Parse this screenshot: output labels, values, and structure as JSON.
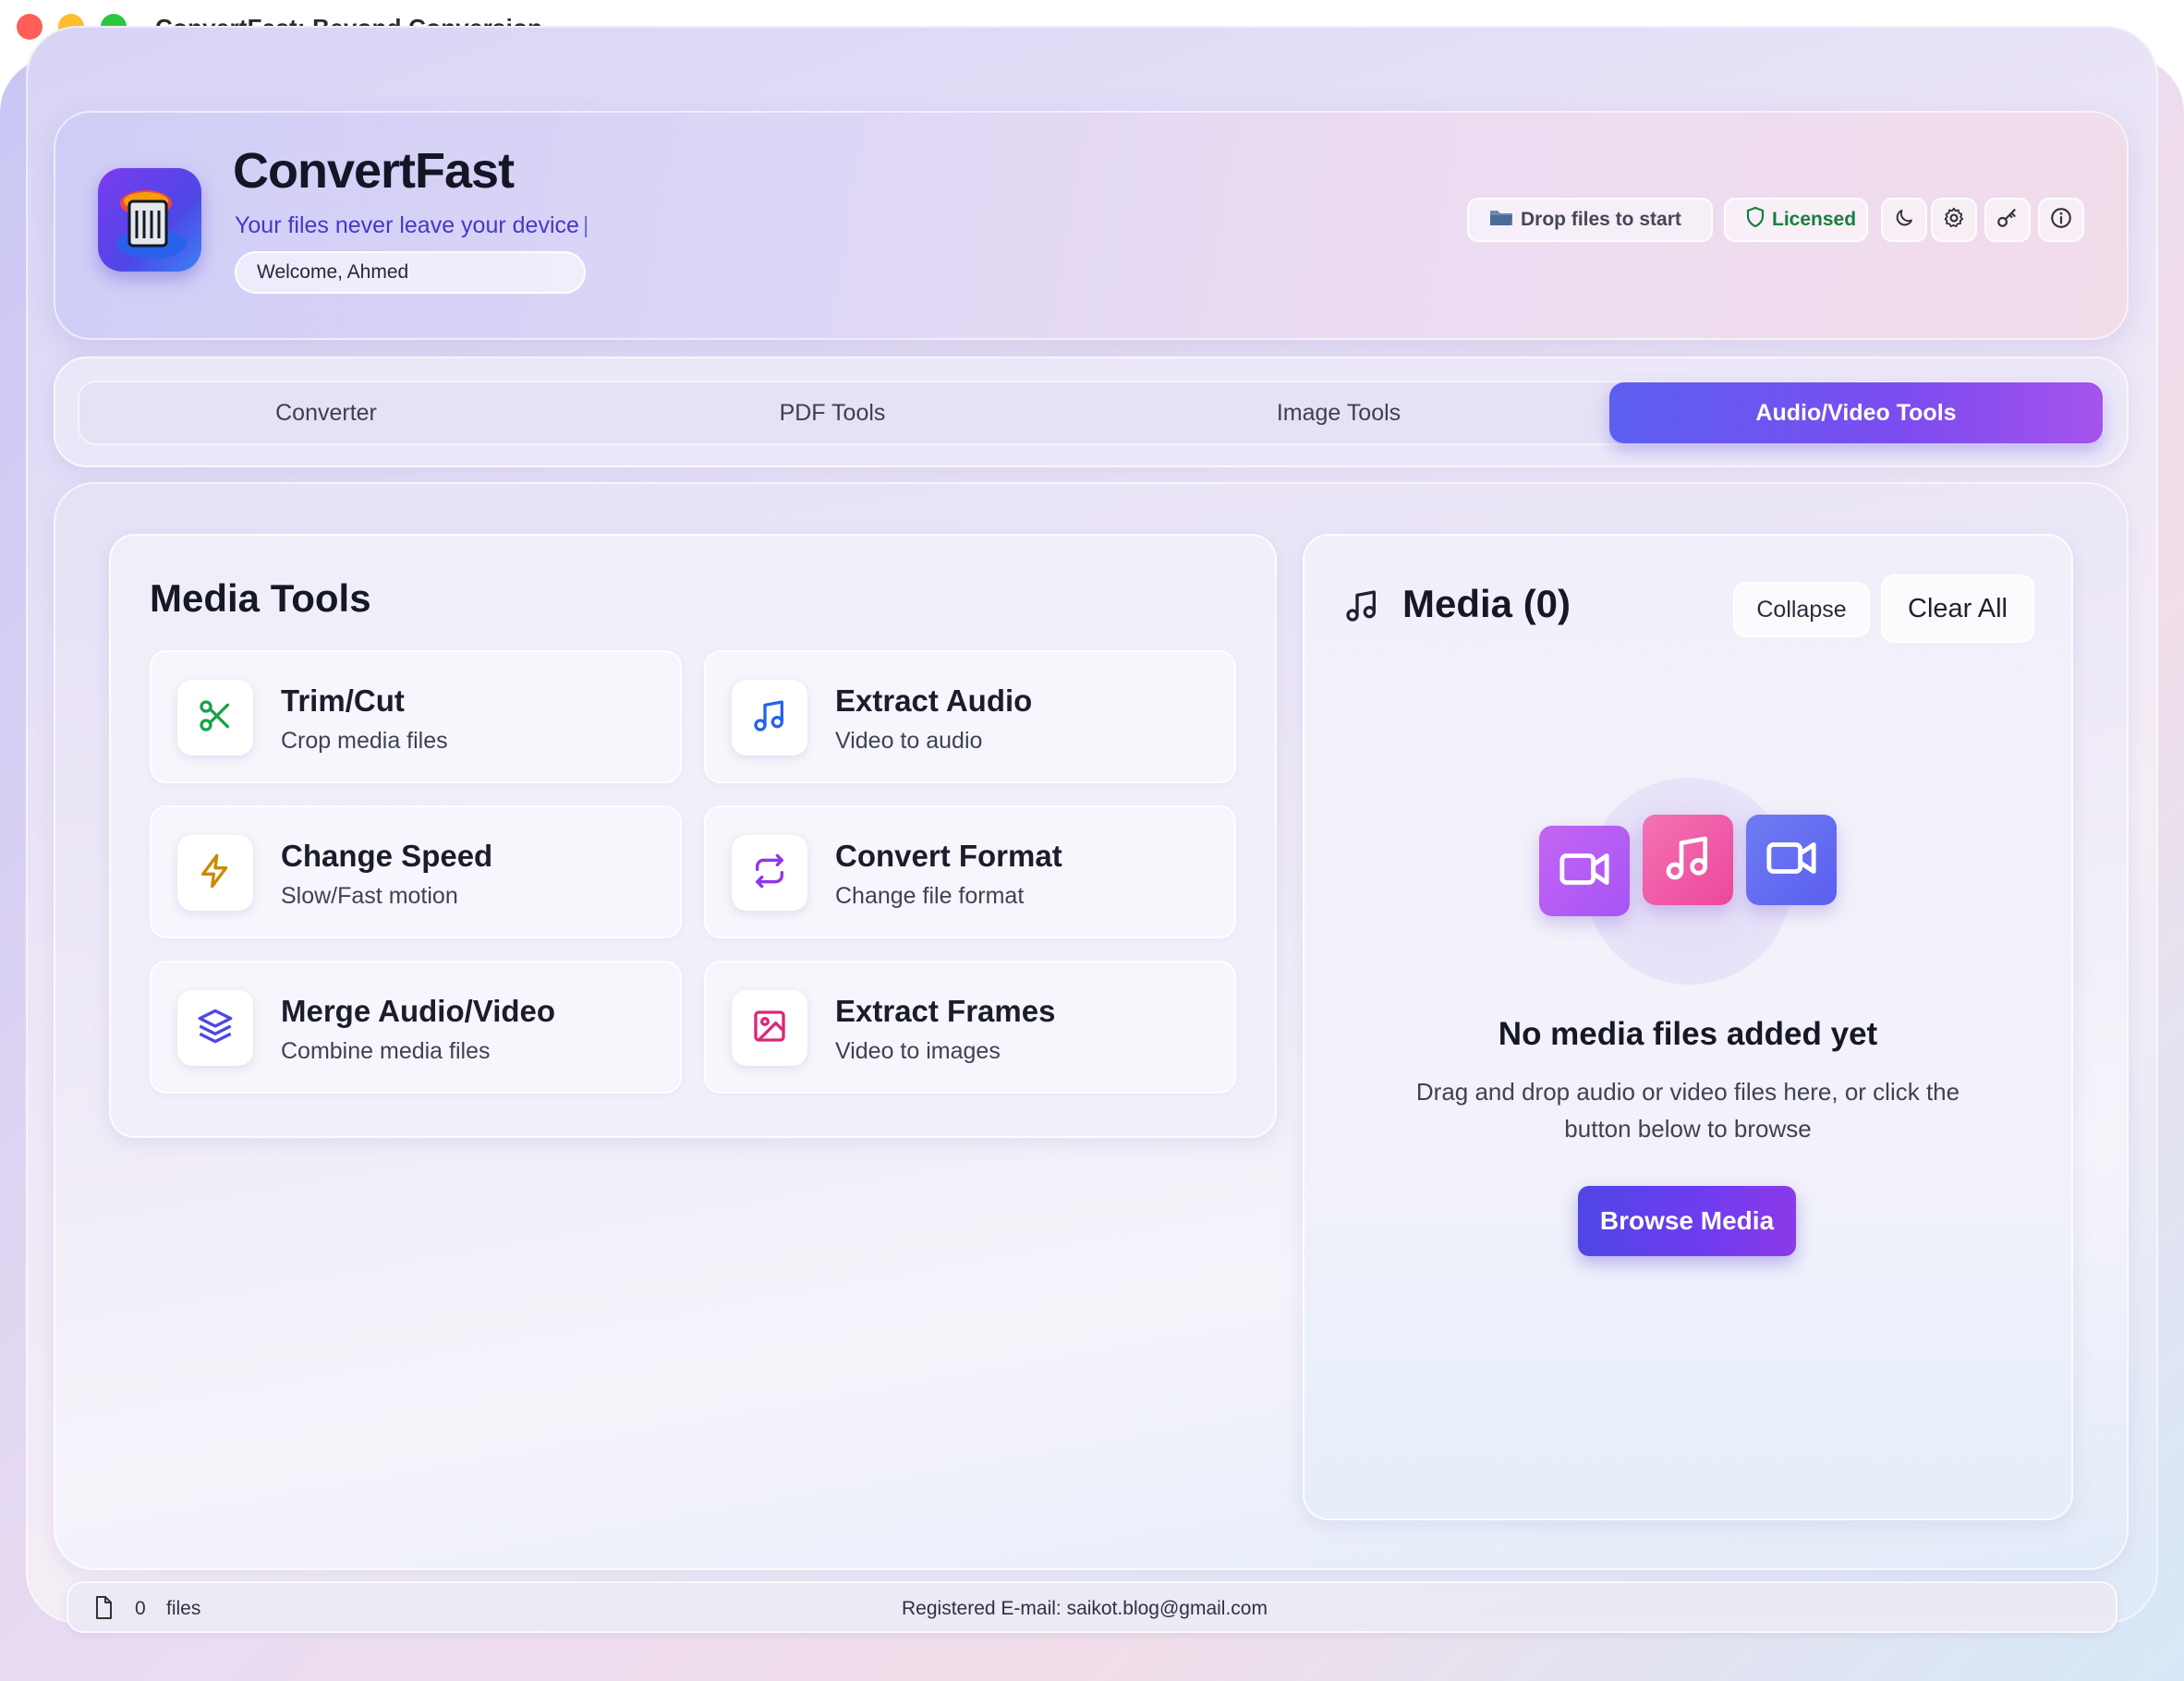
{
  "window": {
    "title": "ConvertFast: Beyond Conversion"
  },
  "header": {
    "brand": "ConvertFast",
    "tagline": "Your files never leave your device",
    "welcome": "Welcome, Ahmed",
    "drop_chip": "Drop files to start",
    "license_chip": "Licensed",
    "icons": [
      "folder-icon",
      "shield-icon",
      "moon-icon",
      "gear-icon",
      "key-icon",
      "info-icon"
    ]
  },
  "tabs": [
    {
      "label": "Converter",
      "active": false
    },
    {
      "label": "PDF Tools",
      "active": false
    },
    {
      "label": "Image Tools",
      "active": false
    },
    {
      "label": "Audio/Video Tools",
      "active": true
    }
  ],
  "tools_panel": {
    "title": "Media Tools",
    "tools": [
      {
        "title": "Trim/Cut",
        "subtitle": "Crop media files",
        "icon": "scissors-icon",
        "color": "#16a34a"
      },
      {
        "title": "Extract Audio",
        "subtitle": "Video to audio",
        "icon": "music-note-icon",
        "color": "#2563eb"
      },
      {
        "title": "Change Speed",
        "subtitle": "Slow/Fast motion",
        "icon": "lightning-icon",
        "color": "#ca8a04"
      },
      {
        "title": "Convert Format",
        "subtitle": "Change file format",
        "icon": "repeat-icon",
        "color": "#9333ea"
      },
      {
        "title": "Merge Audio/Video",
        "subtitle": "Combine media files",
        "icon": "layers-icon",
        "color": "#4f46e5"
      },
      {
        "title": "Extract Frames",
        "subtitle": "Video to images",
        "icon": "image-icon",
        "color": "#db2777"
      }
    ]
  },
  "media_panel": {
    "title": "Media (0)",
    "collapse_label": "Collapse",
    "clear_label": "Clear All",
    "empty_title": "No media files added yet",
    "empty_desc": "Drag and drop audio or video files here, or click the button below to browse",
    "browse_label": "Browse Media"
  },
  "statusbar": {
    "count": "0",
    "files_label": "files",
    "email": "Registered E-mail: saikot.blog@gmail.com"
  },
  "colors": {
    "accent": "#5b5ff0",
    "accent_end": "#a553ec",
    "licensed": "#15803d",
    "tagline": "#4338ca"
  }
}
